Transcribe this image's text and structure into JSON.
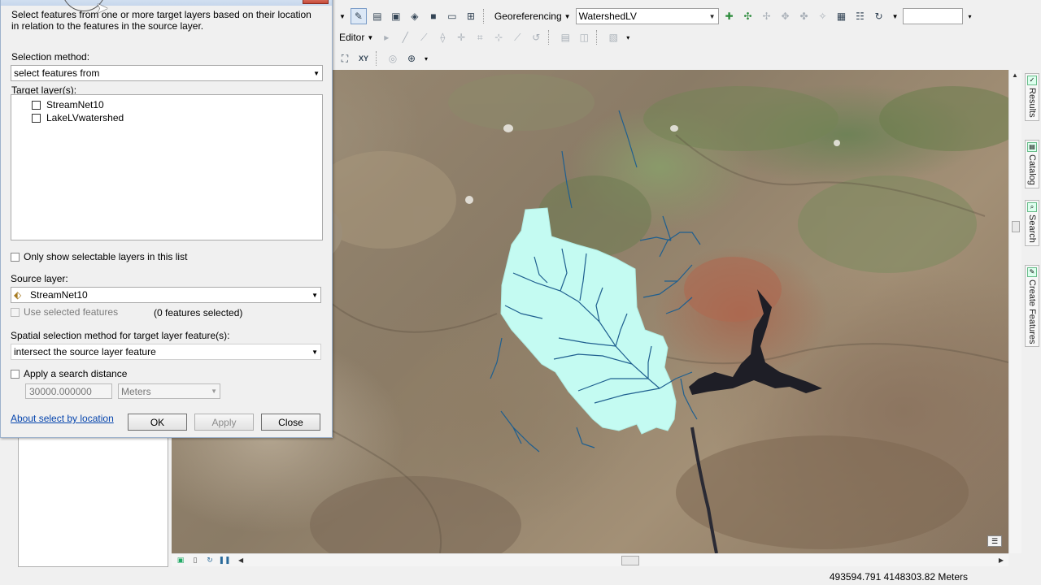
{
  "toolbar": {
    "georef_label": "Georeferencing",
    "layer_combo_value": "WatershedLV",
    "editor_label": "Editor",
    "scale_value": ""
  },
  "dialog": {
    "description": "Select features from one or more target layers based on their location in relation to the features in the source layer.",
    "selection_method_label": "Selection method:",
    "selection_method_value": "select features from",
    "target_layers_label": "Target layer(s):",
    "target_layers": [
      {
        "name": "StreamNet10",
        "checked": false
      },
      {
        "name": "LakeLVwatershed",
        "checked": false
      }
    ],
    "only_selectable_label": "Only show selectable layers in this list",
    "source_layer_label": "Source layer:",
    "source_layer_value": "StreamNet10",
    "use_selected_label": "Use selected features",
    "features_selected": "(0 features selected)",
    "spatial_method_label": "Spatial selection method for target layer feature(s):",
    "spatial_method_value": "intersect the source layer feature",
    "search_distance_label": "Apply a search distance",
    "search_distance_value": "30000.000000",
    "distance_units": "Meters",
    "about_link": "About select by location",
    "ok_label": "OK",
    "apply_label": "Apply",
    "close_label": "Close"
  },
  "dock": {
    "results": "Results",
    "catalog": "Catalog",
    "search": "Search",
    "create_features": "Create Features"
  },
  "status": {
    "coordinates": "493594.791  4148303.82 Meters"
  },
  "colors": {
    "watershed_fill": "#c4fbf2",
    "stream": "#1f5f8f",
    "lake": "#1e1e26",
    "link": "#0645ad"
  }
}
